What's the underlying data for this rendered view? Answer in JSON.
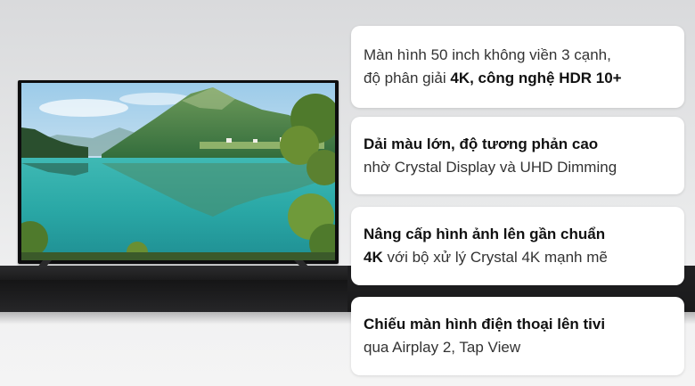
{
  "features": [
    {
      "line1_normal": "Màn hình 50 inch không viền 3 cạnh,",
      "line2_normal": "độ phân giải ",
      "line2_bold": "4K, công nghệ HDR 10+"
    },
    {
      "line1_bold": "Dải màu lớn, độ tương phản cao",
      "line2_normal": "nhờ Crystal Display và UHD Dimming"
    },
    {
      "line1_bold": "Nâng cấp hình ảnh lên gần chuẩn",
      "line2_bold": "4K",
      "line2_normal": " với bộ xử lý Crystal 4K mạnh mẽ"
    },
    {
      "line1_bold": "Chiếu màn hình điện thoại lên tivi",
      "line2_normal": "qua Airplay 2, Tap View"
    }
  ],
  "colors": {
    "card_bg": "#ffffff",
    "text": "#333333",
    "wall": "#e6e7e8",
    "shelf": "#1b1b1c"
  }
}
